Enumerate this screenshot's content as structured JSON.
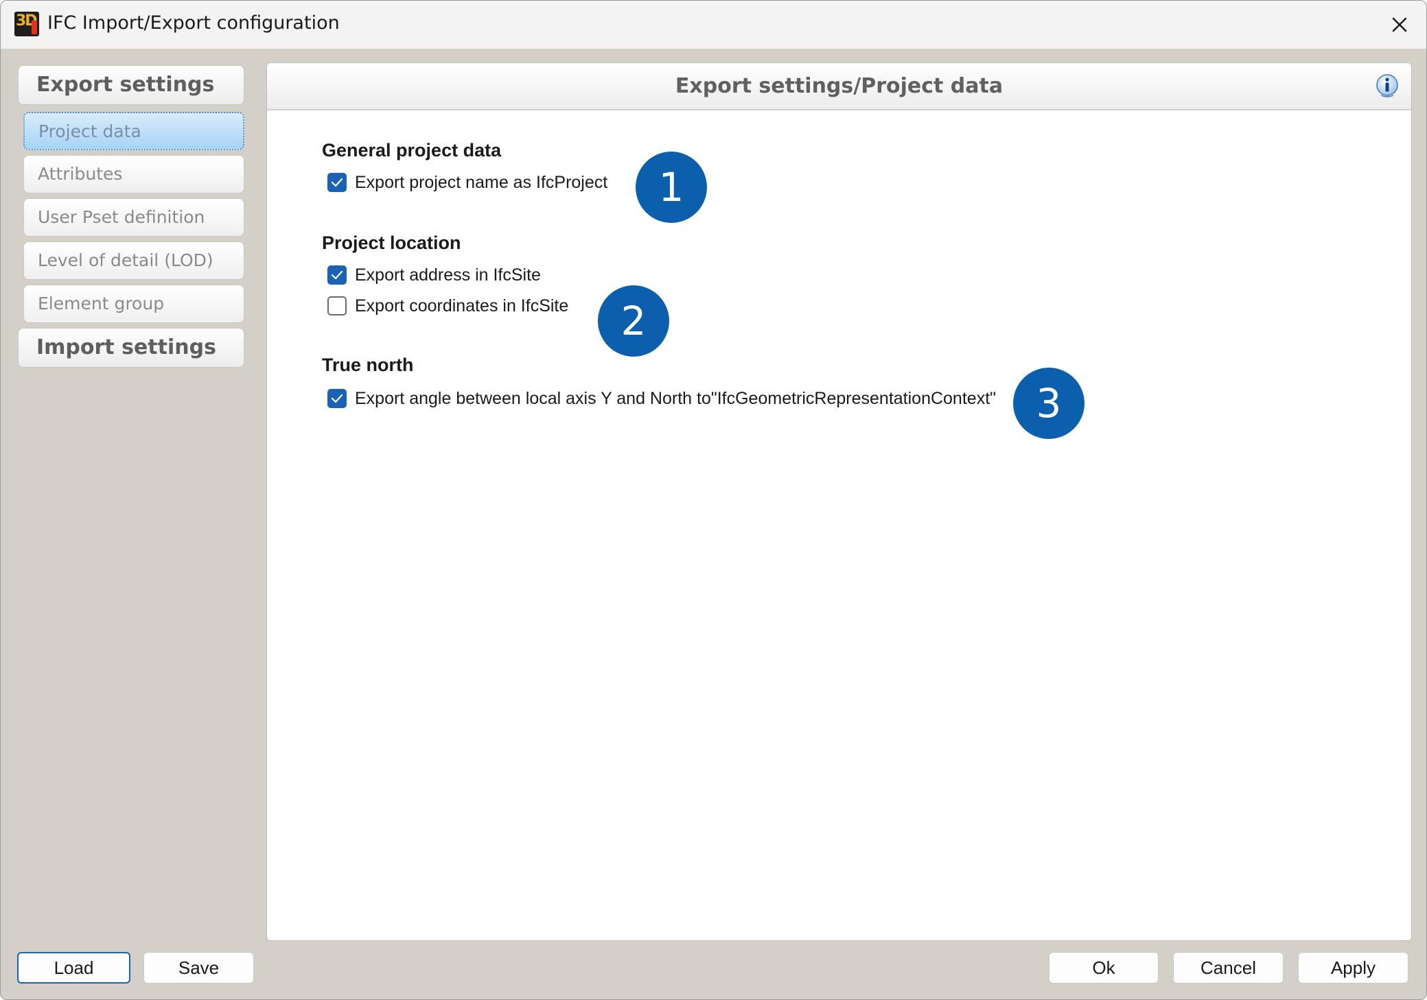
{
  "window": {
    "title": "IFC Import/Export configuration",
    "app_icon": "3d-app-icon",
    "close_icon": "close-icon"
  },
  "sidebar": {
    "export_header": "Export settings",
    "items": [
      {
        "label": "Project data",
        "selected": true
      },
      {
        "label": "Attributes",
        "selected": false
      },
      {
        "label": "User Pset definition",
        "selected": false
      },
      {
        "label": "Level of detail (LOD)",
        "selected": false
      },
      {
        "label": "Element group",
        "selected": false
      }
    ],
    "import_header": "Import settings"
  },
  "panel": {
    "title": "Export settings/Project data",
    "info_icon": "info-icon",
    "sections": [
      {
        "title": "General project data",
        "options": [
          {
            "label": "Export project name as IfcProject",
            "checked": true
          }
        ]
      },
      {
        "title": "Project location",
        "options": [
          {
            "label": "Export address in IfcSite",
            "checked": true
          },
          {
            "label": "Export coordinates in IfcSite",
            "checked": false
          }
        ]
      },
      {
        "title": "True north",
        "options": [
          {
            "label": "Export angle between local axis Y and North to\"IfcGeometricRepresentationContext\"",
            "checked": true
          }
        ]
      }
    ],
    "callouts": [
      "1",
      "2",
      "3"
    ]
  },
  "footer": {
    "load_label": "Load",
    "save_label": "Save",
    "ok_label": "Ok",
    "cancel_label": "Cancel",
    "apply_label": "Apply"
  },
  "colors": {
    "window_bg": "#d4d0c8",
    "accent": "#1a62b3",
    "callout": "#0b5fad",
    "selected_item": "#a7d3f6"
  }
}
